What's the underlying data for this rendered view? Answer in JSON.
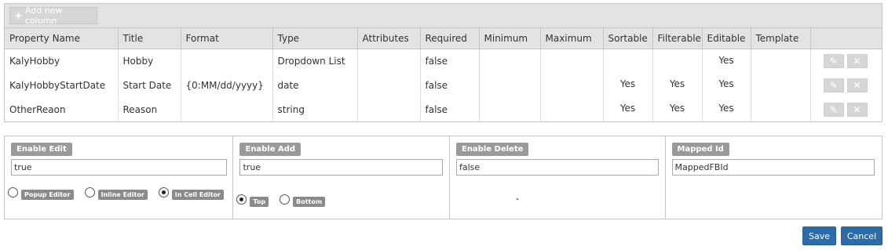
{
  "toolbar": {
    "add_column_label": "Add new column"
  },
  "grid": {
    "headers": [
      "Property Name",
      "Title",
      "Format",
      "Type",
      "Attributes",
      "Required",
      "Minimum",
      "Maximum",
      "Sortable",
      "Filterable",
      "Editable",
      "Template",
      ""
    ],
    "rows": [
      {
        "property_name": "KalyHobby",
        "title": "Hobby",
        "format": "",
        "type": "Dropdown List",
        "attributes": "",
        "required": "false",
        "minimum": "",
        "maximum": "",
        "sortable": "",
        "filterable": "",
        "editable": "Yes",
        "template": ""
      },
      {
        "property_name": "KalyHobbyStartDate",
        "title": "Start Date",
        "format": "{0:MM/dd/yyyy}",
        "type": "date",
        "attributes": "",
        "required": "false",
        "minimum": "",
        "maximum": "",
        "sortable": "Yes",
        "filterable": "Yes",
        "editable": "Yes",
        "template": ""
      },
      {
        "property_name": "OtherReaon",
        "title": "Reason",
        "format": "",
        "type": "string",
        "attributes": "",
        "required": "false",
        "minimum": "",
        "maximum": "",
        "sortable": "Yes",
        "filterable": "Yes",
        "editable": "Yes",
        "template": ""
      }
    ]
  },
  "settings": {
    "enable_edit": {
      "label": "Enable Edit",
      "value": "true",
      "options": [
        "Popup Editor",
        "Inline Editor",
        "In Cell Editor"
      ],
      "selected": "In Cell Editor"
    },
    "enable_add": {
      "label": "Enable Add",
      "value": "true",
      "options": [
        "Top",
        "Bottom"
      ],
      "selected": "Top"
    },
    "enable_delete": {
      "label": "Enable Delete",
      "value": "false"
    },
    "mapped_id": {
      "label": "Mapped Id",
      "value": "MappedFBId"
    }
  },
  "actions": {
    "save_label": "Save",
    "cancel_label": "Cancel"
  },
  "icons": {
    "add": "plus-icon",
    "edit": "pencil-icon",
    "delete": "close-icon"
  },
  "colors": {
    "primary": "#2d6ca8",
    "header_bg": "#e3e3e3",
    "badge_bg": "#9a9a9a"
  }
}
